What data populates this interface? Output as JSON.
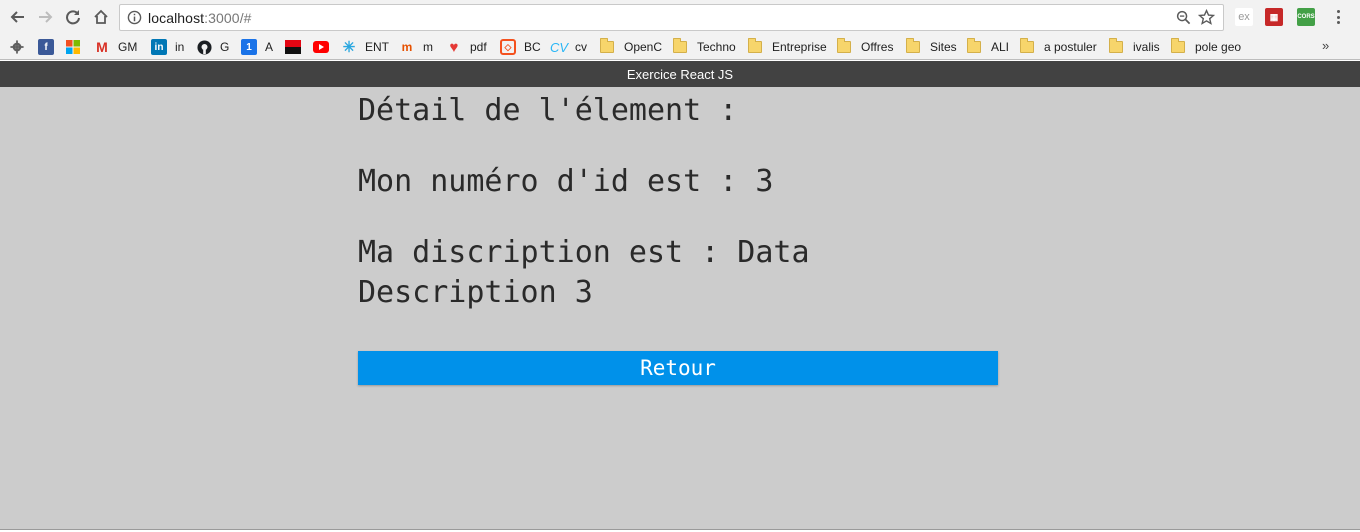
{
  "browser": {
    "url_host": "localhost",
    "url_rest": ":3000/#",
    "bookmarks": [
      {
        "label": "",
        "icon": "gear-icon"
      },
      {
        "label": "",
        "icon": "facebook-icon"
      },
      {
        "label": "",
        "icon": "microsoft-icon"
      },
      {
        "label": "GM",
        "icon": "gmail-icon"
      },
      {
        "label": "in",
        "icon": "linkedin-icon"
      },
      {
        "label": "G",
        "icon": "github-icon"
      },
      {
        "label": "A",
        "icon": "calendar-icon"
      },
      {
        "label": "",
        "icon": "bank-icon"
      },
      {
        "label": "",
        "icon": "youtube-icon"
      },
      {
        "label": "ENT",
        "icon": "ent-icon"
      },
      {
        "label": "m",
        "icon": "m-icon"
      },
      {
        "label": "pdf",
        "icon": "heart-icon"
      },
      {
        "label": "BC",
        "icon": "cube-icon"
      },
      {
        "label": "cv",
        "icon": "cv-icon"
      },
      {
        "label": "OpenC",
        "icon": "folder-icon"
      },
      {
        "label": "Techno",
        "icon": "folder-icon"
      },
      {
        "label": "Entreprise",
        "icon": "folder-icon"
      },
      {
        "label": "Offres",
        "icon": "folder-icon"
      },
      {
        "label": "Sites",
        "icon": "folder-icon"
      },
      {
        "label": "ALI",
        "icon": "folder-icon"
      },
      {
        "label": "a postuler",
        "icon": "folder-icon"
      },
      {
        "label": "ivalis",
        "icon": "folder-icon"
      },
      {
        "label": "pole geo",
        "icon": "folder-icon"
      }
    ],
    "overflow_label": "»",
    "extensions": {
      "ex": "ex",
      "cors": "CORS"
    }
  },
  "app": {
    "header_title": "Exercice React JS",
    "detail_heading": "Détail de l'élement :",
    "id_line": "Mon numéro d'id est : 3",
    "desc_line": "Ma discription est : Data Description 3",
    "back_button": "Retour"
  },
  "colors": {
    "header_bg": "#424242",
    "content_bg": "#cccccc",
    "button_bg": "#0091ea"
  }
}
